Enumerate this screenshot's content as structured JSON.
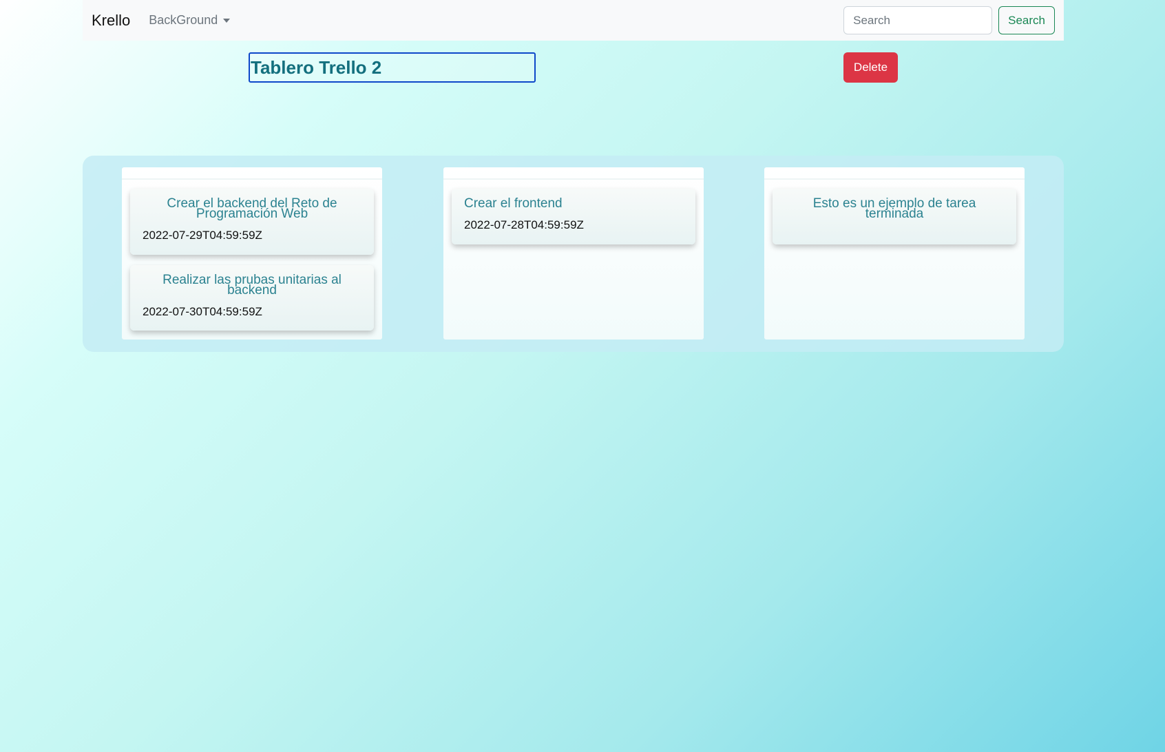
{
  "navbar": {
    "brand": "Krello",
    "dropdown_label": "BackGround",
    "search_placeholder": "Search",
    "search_button": "Search"
  },
  "board": {
    "title": "Tablero Trello 2",
    "delete_label": "Delete"
  },
  "columns": [
    {
      "cards": [
        {
          "title": "Crear el backend del Reto de Programación Web",
          "date": "2022-07-29T04:59:59Z"
        },
        {
          "title": "Realizar las prubas unitarias al backend",
          "date": "2022-07-30T04:59:59Z"
        }
      ]
    },
    {
      "cards": [
        {
          "title": "Crear el frontend",
          "date": "2022-07-28T04:59:59Z"
        }
      ]
    },
    {
      "cards": [
        {
          "title": "Esto es un ejemplo de tarea terminada",
          "date": ""
        }
      ]
    }
  ],
  "colors": {
    "delete": "#dc3545",
    "search_outline": "#198754",
    "card_title": "#2b8290",
    "board_title": "#136f7e"
  }
}
